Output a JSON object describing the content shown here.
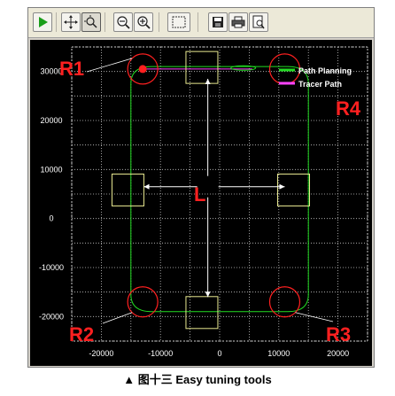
{
  "toolbar": {
    "items": [
      {
        "name": "run-icon",
        "color": "#1a9e1a"
      },
      {
        "name": "pan-icon"
      },
      {
        "name": "zoom-fit-icon"
      },
      {
        "name": "zoom-out-icon"
      },
      {
        "name": "zoom-in-icon"
      },
      {
        "name": "select-box-icon"
      },
      {
        "name": "save-icon"
      },
      {
        "name": "print-icon"
      },
      {
        "name": "print-preview-icon"
      }
    ]
  },
  "chart_data": {
    "type": "line",
    "xlim": [
      -25000,
      25000
    ],
    "ylim": [
      -25000,
      35000
    ],
    "x_ticks": [
      "-20000",
      "-10000",
      "0",
      "10000",
      "20000"
    ],
    "y_ticks": [
      "30000",
      "20000",
      "10000",
      "0",
      "-10000",
      "-20000"
    ],
    "grid": true,
    "legend_position": "top-right",
    "series": [
      {
        "name": "Path Planning",
        "color": "#22dd22"
      },
      {
        "name": "Tracer Path",
        "color": "#ff44ff"
      }
    ]
  },
  "annotations": {
    "r1": "R1",
    "r2": "R2",
    "r3": "R3",
    "r4": "R4",
    "l": "L",
    "color": "#ff2020"
  },
  "caption": "▲  图十三  Easy tuning tools"
}
